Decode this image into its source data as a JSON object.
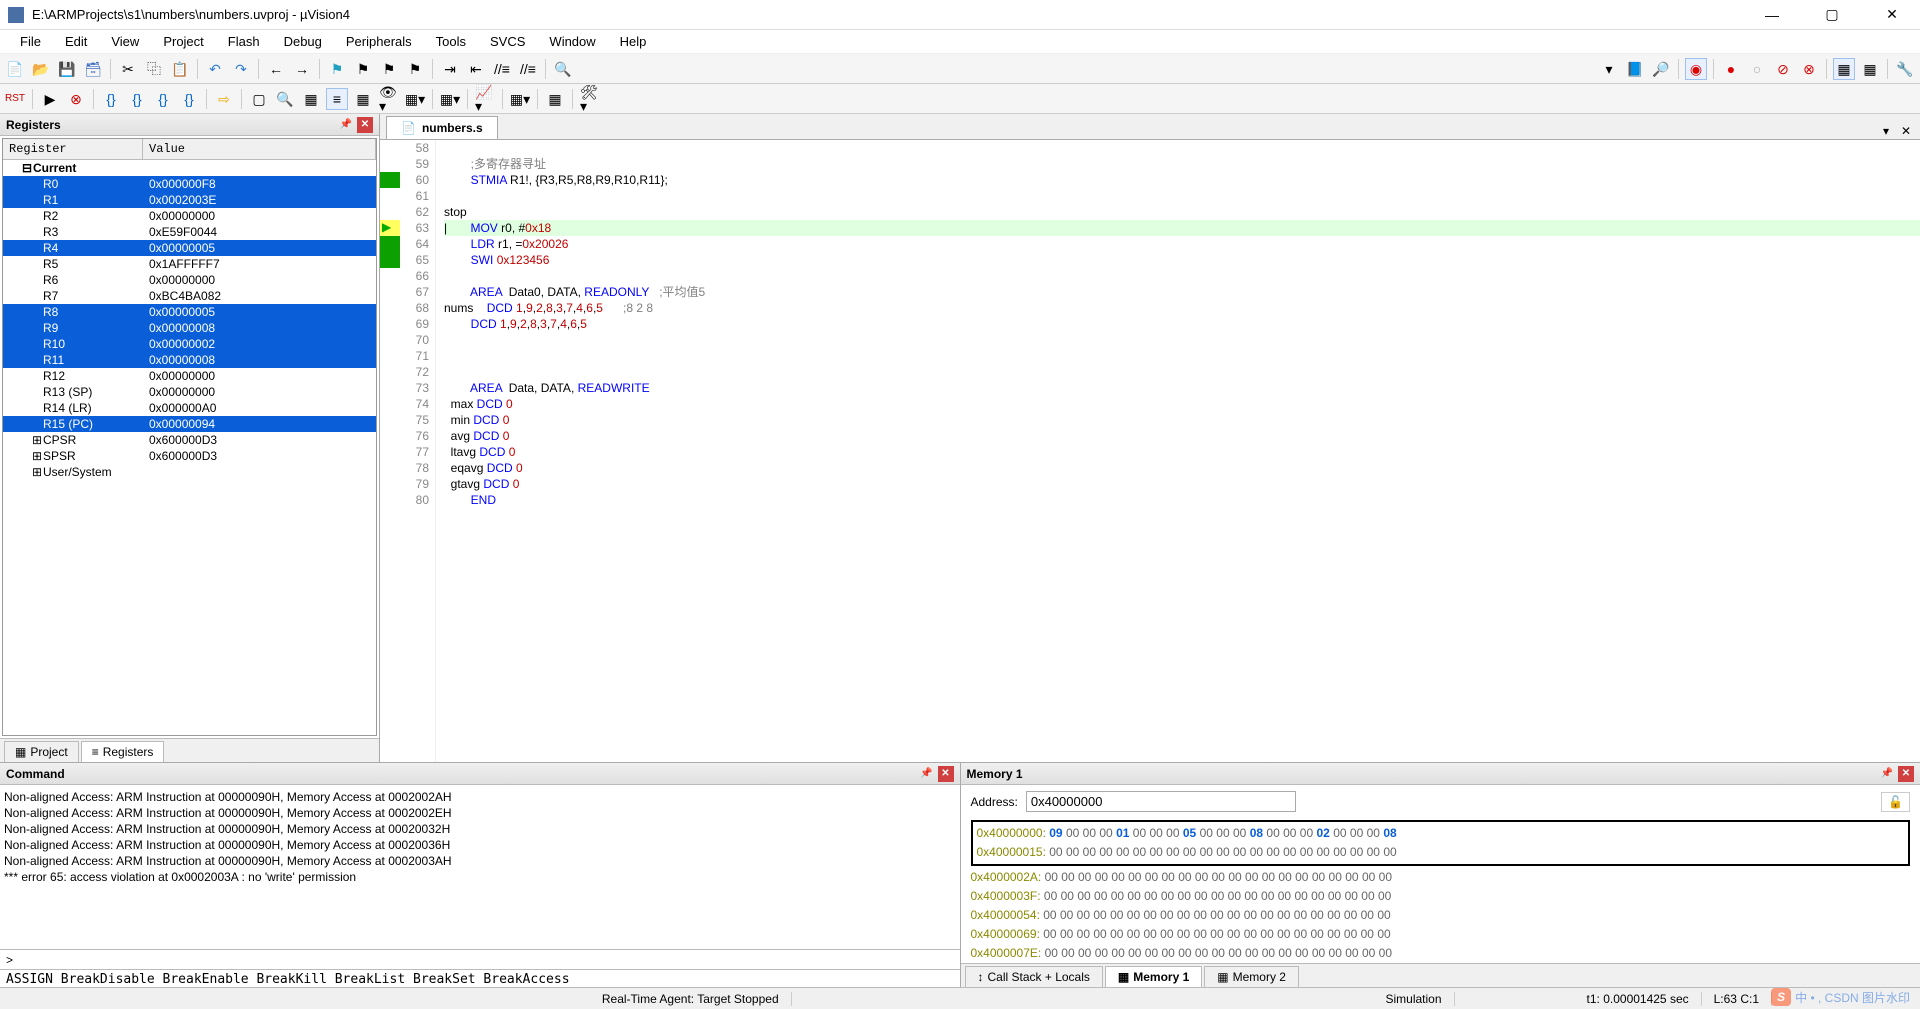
{
  "window": {
    "title": "E:\\ARMProjects\\s1\\numbers\\numbers.uvproj - µVision4"
  },
  "menu": [
    "File",
    "Edit",
    "View",
    "Project",
    "Flash",
    "Debug",
    "Peripherals",
    "Tools",
    "SVCS",
    "Window",
    "Help"
  ],
  "registers_panel": {
    "title": "Registers",
    "col1": "Register",
    "col2": "Value",
    "group": "Current",
    "rows": [
      {
        "name": "R0",
        "value": "0x000000F8",
        "hl": true
      },
      {
        "name": "R1",
        "value": "0x0002003E",
        "hl": true
      },
      {
        "name": "R2",
        "value": "0x00000000",
        "hl": false
      },
      {
        "name": "R3",
        "value": "0xE59F0044",
        "hl": false
      },
      {
        "name": "R4",
        "value": "0x00000005",
        "hl": true
      },
      {
        "name": "R5",
        "value": "0x1AFFFFF7",
        "hl": false
      },
      {
        "name": "R6",
        "value": "0x00000000",
        "hl": false
      },
      {
        "name": "R7",
        "value": "0xBC4BA082",
        "hl": false
      },
      {
        "name": "R8",
        "value": "0x00000005",
        "hl": true
      },
      {
        "name": "R9",
        "value": "0x00000008",
        "hl": true
      },
      {
        "name": "R10",
        "value": "0x00000002",
        "hl": true
      },
      {
        "name": "R11",
        "value": "0x00000008",
        "hl": true
      },
      {
        "name": "R12",
        "value": "0x00000000",
        "hl": false
      },
      {
        "name": "R13 (SP)",
        "value": "0x00000000",
        "hl": false
      },
      {
        "name": "R14 (LR)",
        "value": "0x000000A0",
        "hl": false
      },
      {
        "name": "R15 (PC)",
        "value": "0x00000094",
        "hl": true
      }
    ],
    "extras": [
      {
        "name": "CPSR",
        "value": "0x600000D3"
      },
      {
        "name": "SPSR",
        "value": "0x600000D3"
      },
      {
        "name": "User/System",
        "value": ""
      }
    ]
  },
  "left_tabs": {
    "project": "Project",
    "registers": "Registers"
  },
  "editor": {
    "tab_name": "numbers.s",
    "first_line": 58,
    "lines": [
      {
        "n": 58,
        "html": ""
      },
      {
        "n": 59,
        "html": "        <span class='cmt'>;多寄存器寻址</span>"
      },
      {
        "n": 60,
        "html": "        <span class='kw'>STMIA</span> R1!, {R3,R5,R8,R9,R10,R11};",
        "mark": "green"
      },
      {
        "n": 61,
        "html": ""
      },
      {
        "n": 62,
        "html": "stop"
      },
      {
        "n": 63,
        "html": "|       <span class='kw'>MOV</span> r0, #<span class='num'>0x18</span>",
        "mark": "cursor",
        "cur": true
      },
      {
        "n": 64,
        "html": "        <span class='kw'>LDR</span> r1, =<span class='num'>0x20026</span>",
        "mark": "green"
      },
      {
        "n": 65,
        "html": "        <span class='kw'>SWI</span> <span class='num'>0x123456</span>",
        "mark": "green"
      },
      {
        "n": 66,
        "html": ""
      },
      {
        "n": 67,
        "html": "        <span class='kw'>AREA</span>  Data0, DATA, <span class='kw'>READONLY</span>   <span class='cmt'>;平均值5</span>"
      },
      {
        "n": 68,
        "html": "nums    <span class='kw'>DCD</span> <span class='num'>1</span>,<span class='num'>9</span>,<span class='num'>2</span>,<span class='num'>8</span>,<span class='num'>3</span>,<span class='num'>7</span>,<span class='num'>4</span>,<span class='num'>6</span>,<span class='num'>5</span>      <span class='cmt'>;8 2 8</span>"
      },
      {
        "n": 69,
        "html": "        <span class='kw'>DCD</span> <span class='num'>1</span>,<span class='num'>9</span>,<span class='num'>2</span>,<span class='num'>8</span>,<span class='num'>3</span>,<span class='num'>7</span>,<span class='num'>4</span>,<span class='num'>6</span>,<span class='num'>5</span>"
      },
      {
        "n": 70,
        "html": ""
      },
      {
        "n": 71,
        "html": ""
      },
      {
        "n": 72,
        "html": ""
      },
      {
        "n": 73,
        "html": "        <span class='kw'>AREA</span>  Data, DATA, <span class='kw'>READWRITE</span>"
      },
      {
        "n": 74,
        "html": "  max <span class='kw'>DCD</span> <span class='num'>0</span>"
      },
      {
        "n": 75,
        "html": "  min <span class='kw'>DCD</span> <span class='num'>0</span>"
      },
      {
        "n": 76,
        "html": "  avg <span class='kw'>DCD</span> <span class='num'>0</span>"
      },
      {
        "n": 77,
        "html": "  ltavg <span class='kw'>DCD</span> <span class='num'>0</span>"
      },
      {
        "n": 78,
        "html": "  eqavg <span class='kw'>DCD</span> <span class='num'>0</span>"
      },
      {
        "n": 79,
        "html": "  gtavg <span class='kw'>DCD</span> <span class='num'>0</span>"
      },
      {
        "n": 80,
        "html": "        <span class='kw'>END</span>"
      }
    ]
  },
  "command": {
    "title": "Command",
    "lines": [
      "Non-aligned Access: ARM Instruction at 00000090H, Memory Access at 0002002AH",
      "Non-aligned Access: ARM Instruction at 00000090H, Memory Access at 0002002EH",
      "Non-aligned Access: ARM Instruction at 00000090H, Memory Access at 00020032H",
      "Non-aligned Access: ARM Instruction at 00000090H, Memory Access at 00020036H",
      "Non-aligned Access: ARM Instruction at 00000090H, Memory Access at 0002003AH",
      "*** error 65: access violation at 0x0002003A : no 'write' permission"
    ],
    "prompt": ">",
    "hints": "ASSIGN BreakDisable BreakEnable BreakKill BreakList BreakSet BreakAccess"
  },
  "memory": {
    "title": "Memory 1",
    "addr_label": "Address:",
    "addr_value": "0x40000000",
    "rows": [
      {
        "addr": "0x40000000:",
        "bytes": [
          "09",
          "00",
          "00",
          "00",
          "01",
          "00",
          "00",
          "00",
          "05",
          "00",
          "00",
          "00",
          "08",
          "00",
          "00",
          "00",
          "02",
          "00",
          "00",
          "00",
          "08"
        ],
        "hl": true,
        "box": true
      },
      {
        "addr": "0x40000015:",
        "bytes": [
          "00",
          "00",
          "00",
          "00",
          "00",
          "00",
          "00",
          "00",
          "00",
          "00",
          "00",
          "00",
          "00",
          "00",
          "00",
          "00",
          "00",
          "00",
          "00",
          "00",
          "00"
        ],
        "hl": false,
        "box": true
      },
      {
        "addr": "0x4000002A:",
        "bytes": [
          "00",
          "00",
          "00",
          "00",
          "00",
          "00",
          "00",
          "00",
          "00",
          "00",
          "00",
          "00",
          "00",
          "00",
          "00",
          "00",
          "00",
          "00",
          "00",
          "00",
          "00"
        ],
        "hl": false
      },
      {
        "addr": "0x4000003F:",
        "bytes": [
          "00",
          "00",
          "00",
          "00",
          "00",
          "00",
          "00",
          "00",
          "00",
          "00",
          "00",
          "00",
          "00",
          "00",
          "00",
          "00",
          "00",
          "00",
          "00",
          "00",
          "00"
        ],
        "hl": false
      },
      {
        "addr": "0x40000054:",
        "bytes": [
          "00",
          "00",
          "00",
          "00",
          "00",
          "00",
          "00",
          "00",
          "00",
          "00",
          "00",
          "00",
          "00",
          "00",
          "00",
          "00",
          "00",
          "00",
          "00",
          "00",
          "00"
        ],
        "hl": false
      },
      {
        "addr": "0x40000069:",
        "bytes": [
          "00",
          "00",
          "00",
          "00",
          "00",
          "00",
          "00",
          "00",
          "00",
          "00",
          "00",
          "00",
          "00",
          "00",
          "00",
          "00",
          "00",
          "00",
          "00",
          "00",
          "00"
        ],
        "hl": false
      },
      {
        "addr": "0x4000007E:",
        "bytes": [
          "00",
          "00",
          "00",
          "00",
          "00",
          "00",
          "00",
          "00",
          "00",
          "00",
          "00",
          "00",
          "00",
          "00",
          "00",
          "00",
          "00",
          "00",
          "00",
          "00",
          "00"
        ],
        "hl": false
      }
    ],
    "tabs": {
      "callstack": "Call Stack + Locals",
      "mem1": "Memory 1",
      "mem2": "Memory 2"
    }
  },
  "status": {
    "center": "Real-Time Agent: Target Stopped",
    "sim": "Simulation",
    "t1": "t1: 0.00001425 sec",
    "lc": "L:63 C:1"
  },
  "watermark": {
    "logo": "S",
    "text": "中 • , CSDN 图片水印"
  }
}
